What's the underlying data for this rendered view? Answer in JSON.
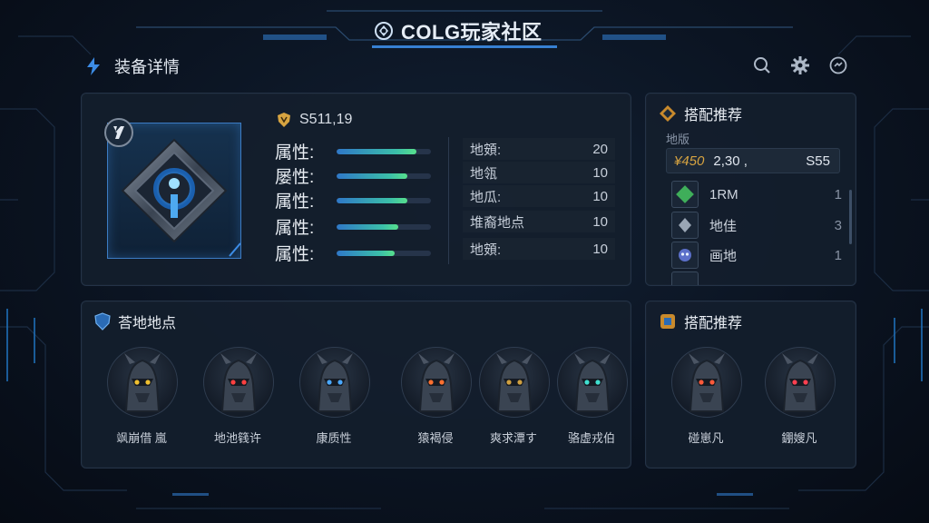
{
  "header": {
    "app_title": "COLG玩家社区",
    "page_title": "装备详情"
  },
  "toolbar": {
    "icons": [
      "search-icon",
      "settings-icon",
      "chat-icon"
    ]
  },
  "item": {
    "name": "S511,19",
    "attributes": [
      {
        "label": "属性:",
        "level": 0.85
      },
      {
        "label": "屡性:",
        "level": 0.75
      },
      {
        "label": "属性:",
        "level": 0.75
      },
      {
        "label": "属性:",
        "level": 0.65
      },
      {
        "label": "属性:",
        "level": 0.62
      }
    ],
    "stats": [
      {
        "label": "地頞:",
        "value": "20"
      },
      {
        "label": "地瓴",
        "value": "10"
      },
      {
        "label": "地瓜:",
        "value": "10"
      },
      {
        "label": "堆裔地点",
        "value": "10"
      },
      {
        "label": "地頞:",
        "value": "10"
      }
    ]
  },
  "recommend": {
    "title": "搭配推荐",
    "subtitle": "地版",
    "price_tag": "¥450",
    "price_value": "2,30 ,",
    "price_right": "S55",
    "items": [
      {
        "label": "1RM",
        "count": "1"
      },
      {
        "label": "地佳",
        "count": "3"
      },
      {
        "label": "画地",
        "count": "1"
      }
    ]
  },
  "drop": {
    "title": "荅地地点",
    "characters": [
      {
        "name": "飒崩借 嵐"
      },
      {
        "name": "地池篯许"
      },
      {
        "name": "康质性"
      },
      {
        "name": "猿褐侵"
      },
      {
        "name": "爽求潭す"
      },
      {
        "name": "骆虚戎伯"
      }
    ]
  },
  "recommend2": {
    "title": "搭配推荐",
    "characters": [
      {
        "name": "碰崽凡"
      },
      {
        "name": "錋嫂凡"
      }
    ]
  },
  "colors": {
    "accent": "#3c8ce6",
    "gold": "#d7a441",
    "bar_end": "#57e08c"
  }
}
